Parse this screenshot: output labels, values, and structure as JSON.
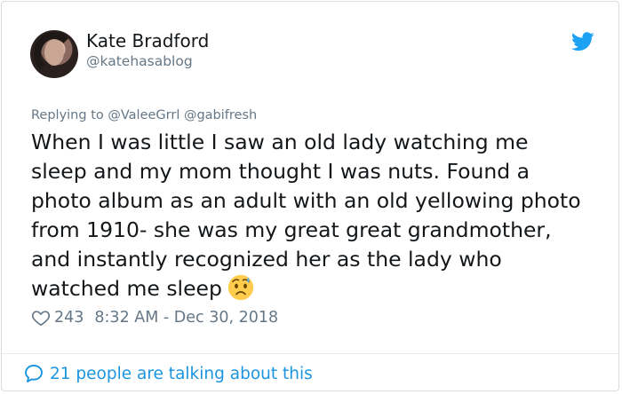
{
  "author": {
    "name": "Kate Bradford",
    "handle": "@katehasablog"
  },
  "reply": {
    "prefix": "Replying to ",
    "mentions": "@ValeeGrrl @gabifresh"
  },
  "tweet": {
    "text": "When I was little I saw an old lady watching me\nsleep and my mom thought I was nuts. Found a\nphoto album as an adult with an old yellowing photo\nfrom 1910- she was my great great grandmother,\nand instantly recognized her as the lady who\nwatched me sleep",
    "emoji": "anxious-face-with-sweat"
  },
  "meta": {
    "likes": "243",
    "timestamp": "8:32 AM - Dec 30, 2018"
  },
  "footer": {
    "talking": "21 people are talking about this"
  },
  "colors": {
    "twitter_blue": "#1da1f2",
    "link_blue": "#1b95e0",
    "secondary_text": "#657786",
    "primary_text": "#14171a"
  },
  "icons": {
    "brand": "twitter-bird-icon",
    "like": "heart-icon",
    "talk": "speech-bubble-icon"
  }
}
